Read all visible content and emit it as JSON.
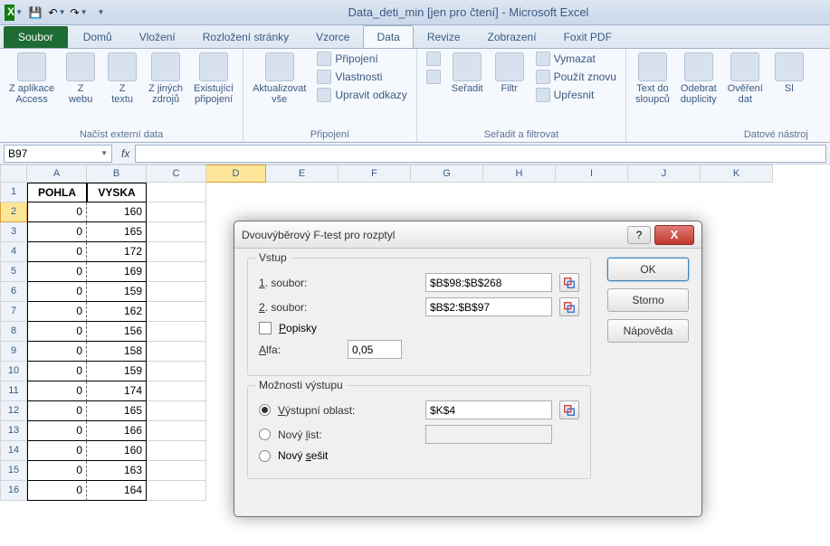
{
  "titlebar": {
    "title": "Data_deti_min  [jen pro čtení] - Microsoft Excel"
  },
  "tabs": {
    "file": "Soubor",
    "items": [
      "Domů",
      "Vložení",
      "Rozložení stránky",
      "Vzorce",
      "Data",
      "Revize",
      "Zobrazení",
      "Foxit PDF"
    ],
    "active": 4
  },
  "ribbon": {
    "g1": {
      "label": "Načíst externí data",
      "btns": [
        "Z aplikace\nAccess",
        "Z\nwebu",
        "Z\ntextu",
        "Z jiných\nzdrojů",
        "Existující\npřipojení"
      ]
    },
    "g2": {
      "label": "Připojení",
      "big": "Aktualizovat\nvše",
      "sm": [
        "Připojení",
        "Vlastnosti",
        "Upravit odkazy"
      ]
    },
    "g3": {
      "label": "Seřadit a filtrovat",
      "sort": "Seřadit",
      "filter": "Filtr",
      "sm": [
        "Vymazat",
        "Použít znovu",
        "Upřesnit"
      ]
    },
    "g4": {
      "label": "Datové nástroj",
      "btns": [
        "Text do\nsloupců",
        "Odebrat\nduplicity",
        "Ověření\ndat",
        "Sl"
      ]
    }
  },
  "namebox": "B97",
  "columns": [
    "A",
    "B",
    "C",
    "D",
    "E",
    "F",
    "G",
    "H",
    "I",
    "J",
    "K"
  ],
  "headers": [
    "POHLA",
    "VYSKA"
  ],
  "rows": [
    {
      "n": 2,
      "a": "0",
      "b": "160"
    },
    {
      "n": 3,
      "a": "0",
      "b": "165"
    },
    {
      "n": 4,
      "a": "0",
      "b": "172"
    },
    {
      "n": 5,
      "a": "0",
      "b": "169"
    },
    {
      "n": 6,
      "a": "0",
      "b": "159"
    },
    {
      "n": 7,
      "a": "0",
      "b": "162"
    },
    {
      "n": 8,
      "a": "0",
      "b": "156"
    },
    {
      "n": 9,
      "a": "0",
      "b": "158"
    },
    {
      "n": 10,
      "a": "0",
      "b": "159"
    },
    {
      "n": 11,
      "a": "0",
      "b": "174"
    },
    {
      "n": 12,
      "a": "0",
      "b": "165"
    },
    {
      "n": 13,
      "a": "0",
      "b": "166"
    },
    {
      "n": 14,
      "a": "0",
      "b": "160"
    },
    {
      "n": 15,
      "a": "0",
      "b": "163"
    },
    {
      "n": 16,
      "a": "0",
      "b": "164"
    }
  ],
  "dialog": {
    "title": "Dvouvýběrový F-test pro rozptyl",
    "grp1": "Vstup",
    "lbl1": "1. soubor:",
    "val1": "$B$98:$B$268",
    "lbl2": "2. soubor:",
    "val2": "$B$2:$B$97",
    "popisky": "Popisky",
    "alfa_lbl": "Alfa:",
    "alfa": "0,05",
    "grp2": "Možnosti výstupu",
    "out_lbl": "Výstupní oblast:",
    "out_val": "$K$4",
    "newlist": "Nový list:",
    "newbook": "Nový sešit",
    "ok": "OK",
    "cancel": "Storno",
    "help": "Nápověda"
  }
}
